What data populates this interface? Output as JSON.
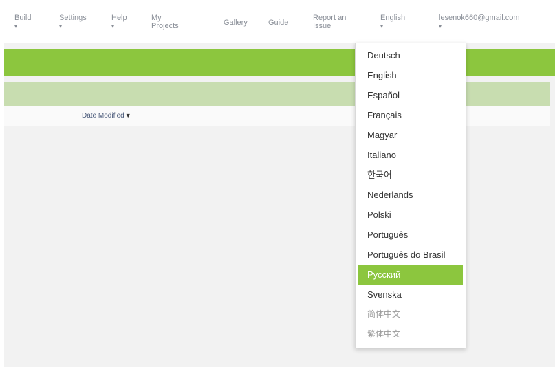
{
  "nav": {
    "build": "Build",
    "settings": "Settings",
    "help": "Help",
    "my_projects": "My\nProjects",
    "gallery": "Gallery",
    "guide": "Guide",
    "report_issue": "Report an\nIssue",
    "language": "English",
    "account": "lesenok660@gmail.com",
    "caret": "▼"
  },
  "table": {
    "sort_header": "Date Modified",
    "sort_arrow": "▼"
  },
  "language_menu": {
    "items": [
      "Deutsch",
      "English",
      "Español",
      "Français",
      "Magyar",
      "Italiano",
      "한국어",
      "Nederlands",
      "Polski",
      "Português",
      "Português do Brasil",
      "Русский",
      "Svenska",
      "简体中文",
      "繁体中文"
    ],
    "selected": "Русский"
  },
  "colors": {
    "accent_green": "#8cc63e",
    "light_green": "#c8ddb0",
    "nav_text": "#8a8f98"
  }
}
